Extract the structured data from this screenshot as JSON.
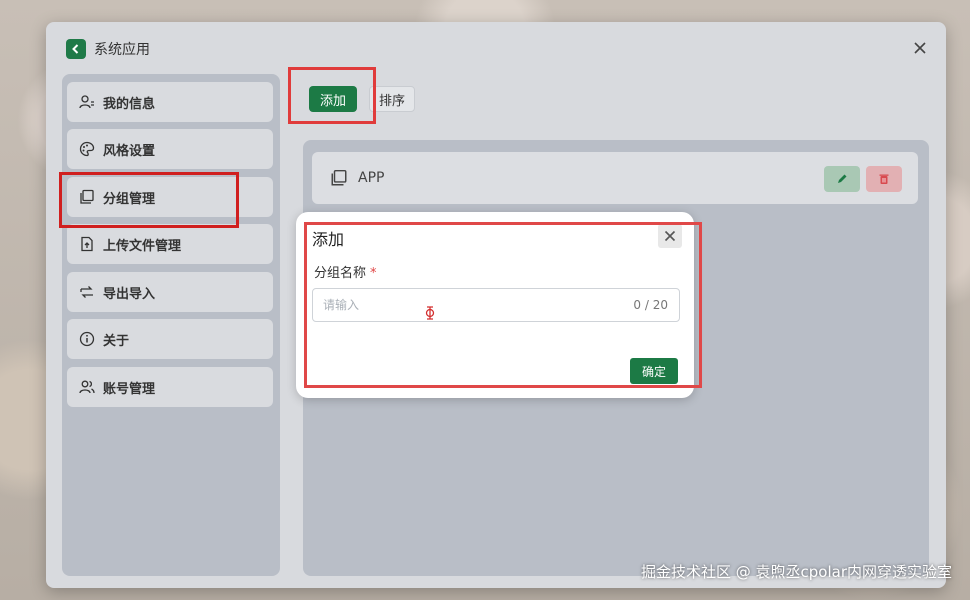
{
  "window": {
    "title": "系统应用"
  },
  "sidebar": {
    "items": [
      {
        "label": "我的信息",
        "icon": "user-info-icon"
      },
      {
        "label": "风格设置",
        "icon": "palette-icon"
      },
      {
        "label": "分组管理",
        "icon": "group-copy-icon"
      },
      {
        "label": "上传文件管理",
        "icon": "file-upload-icon"
      },
      {
        "label": "导出导入",
        "icon": "import-export-icon"
      },
      {
        "label": "关于",
        "icon": "info-icon"
      },
      {
        "label": "账号管理",
        "icon": "users-icon"
      }
    ]
  },
  "toolbar": {
    "add_label": "添加",
    "sort_label": "排序"
  },
  "groups": [
    {
      "name": "APP"
    }
  ],
  "dialog": {
    "title": "添加",
    "field_label": "分组名称",
    "required_mark": "*",
    "placeholder": "请输入",
    "value": "",
    "counter": "0 / 20",
    "confirm_label": "确定"
  },
  "watermark": "掘金技术社区 @ 袁煦丞cpolar内网穿透实验室",
  "colors": {
    "accent": "#1c7a45",
    "highlight": "#e03b3b",
    "danger": "#d84a4f"
  }
}
